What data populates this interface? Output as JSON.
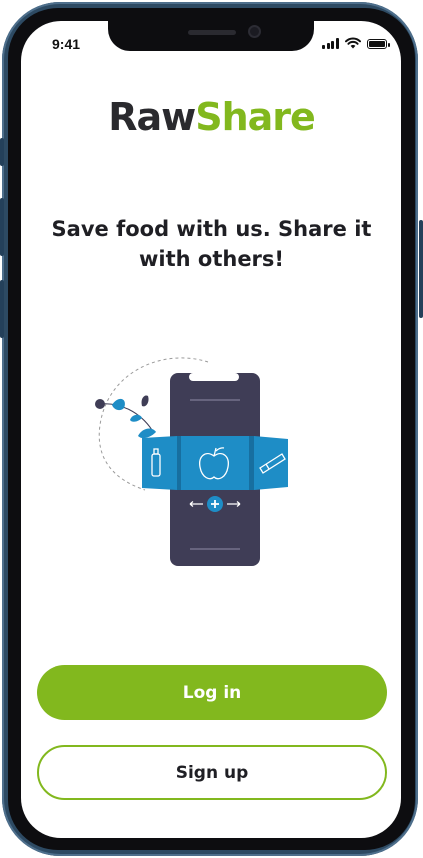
{
  "status_bar": {
    "time": "9:41"
  },
  "brand": {
    "part_one": "Raw",
    "part_two": "Share",
    "color_dark": "#2a2a2e",
    "color_accent": "#82b81e"
  },
  "headline": "Save food with us. Share it with others!",
  "illustration": {
    "icons": [
      "bottle-icon",
      "apple-icon",
      "chocolate-bar-icon",
      "plus-icon",
      "leaf-icon"
    ],
    "colors": {
      "phone": "#3f3d56",
      "panel": "#1e8dc6",
      "panel_dark": "#176fa0"
    }
  },
  "actions": {
    "login_label": "Log in",
    "signup_label": "Sign up"
  }
}
